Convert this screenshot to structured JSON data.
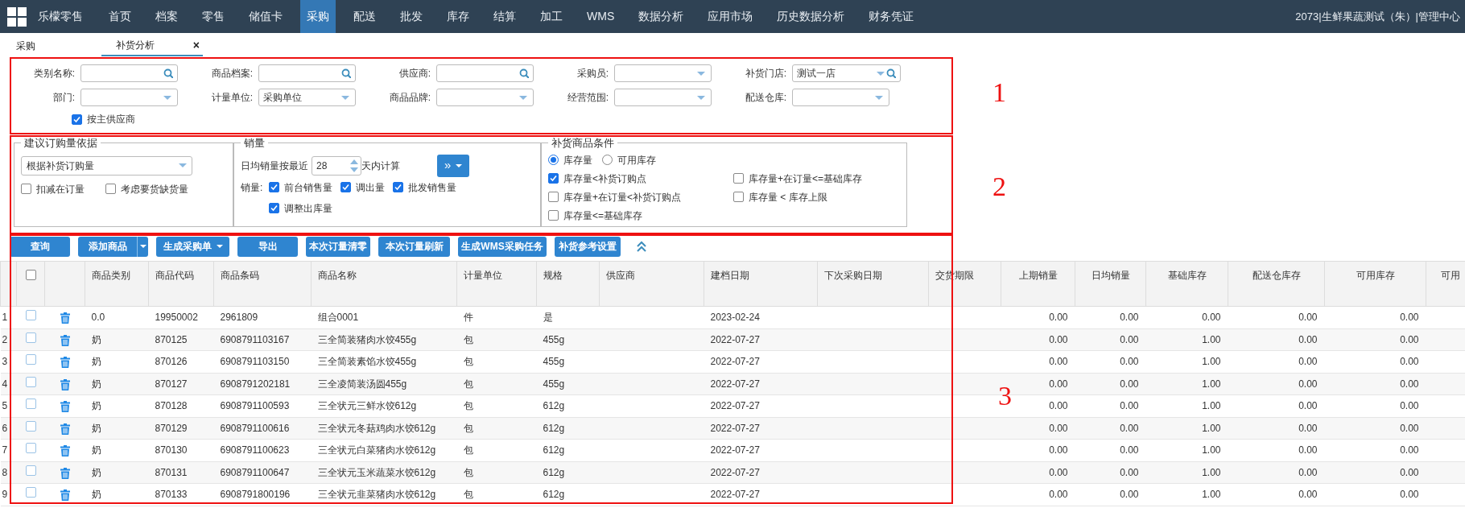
{
  "nav": {
    "brand": "乐檬零售",
    "items": [
      {
        "label": "首页",
        "selected": false
      },
      {
        "label": "档案",
        "selected": false
      },
      {
        "label": "零售",
        "selected": false
      },
      {
        "label": "储值卡",
        "selected": false
      },
      {
        "label": "采购",
        "selected": true
      },
      {
        "label": "配送",
        "selected": false
      },
      {
        "label": "批发",
        "selected": false
      },
      {
        "label": "库存",
        "selected": false
      },
      {
        "label": "结算",
        "selected": false
      },
      {
        "label": "加工",
        "selected": false
      },
      {
        "label": "WMS",
        "selected": false
      },
      {
        "label": "数据分析",
        "selected": false
      },
      {
        "label": "应用市场",
        "selected": false
      },
      {
        "label": "历史数据分析",
        "selected": false
      },
      {
        "label": "财务凭证",
        "selected": false
      }
    ],
    "user": "2073|生鲜果蔬测试（朱）|管理中心"
  },
  "tabs": [
    {
      "label": "采购",
      "selected": false
    },
    {
      "label": "补货分析",
      "selected": true,
      "close": "×"
    }
  ],
  "filters": [
    {
      "label": "类别名称:",
      "kind": "search"
    },
    {
      "label": "商品档案:",
      "kind": "search"
    },
    {
      "label": "供应商:",
      "kind": "search"
    },
    {
      "label": "采购员:",
      "kind": "select"
    },
    {
      "label": "补货门店:",
      "kind": "select_search",
      "value": "测试一店"
    },
    {
      "label": "部门:",
      "kind": "select"
    },
    {
      "label": "计量单位:",
      "kind": "select",
      "value": "采购单位"
    },
    {
      "label": "商品品牌:",
      "kind": "select"
    },
    {
      "label": "经营范围:",
      "kind": "select"
    },
    {
      "label": "配送仓库:",
      "kind": "select"
    }
  ],
  "main_supplier": {
    "label": "按主供应商",
    "checked": true
  },
  "basis": {
    "title": "建议订购量依据",
    "select": "根据补货订购量",
    "options": [
      {
        "label": "扣减在订量",
        "checked": false
      },
      {
        "label": "考虑要货缺货量",
        "checked": false
      }
    ]
  },
  "sales": {
    "title": "销量",
    "prefix": "日均销量按最近",
    "days": "28",
    "suffix": "天内计算",
    "more_button": "»",
    "sales_label": "销量:",
    "options": [
      {
        "label": "前台销售量",
        "checked": true
      },
      {
        "label": "调出量",
        "checked": true
      },
      {
        "label": "批发销售量",
        "checked": true
      },
      {
        "label": "调整出库量",
        "checked": true
      }
    ]
  },
  "conditions": {
    "title": "补货商品条件",
    "radios": [
      {
        "label": "库存量",
        "selected": true
      },
      {
        "label": "可用库存",
        "selected": false
      }
    ],
    "options": [
      {
        "label": "库存量<补货订购点",
        "checked": true
      },
      {
        "label": "库存量+在订量<=基础库存",
        "checked": false
      },
      {
        "label": "库存量+在订量<补货订购点",
        "checked": false
      },
      {
        "label": "库存量 < 库存上限",
        "checked": false
      },
      {
        "label": "库存量<=基础库存",
        "checked": false
      }
    ]
  },
  "toolbar": [
    {
      "label": "查询",
      "kind": "plain"
    },
    {
      "label": "添加商品",
      "kind": "split"
    },
    {
      "label": "生成采购单",
      "kind": "dropdown"
    },
    {
      "label": "导出",
      "kind": "plain"
    },
    {
      "label": "本次订量清零",
      "kind": "plain"
    },
    {
      "label": "本次订量刷新",
      "kind": "plain"
    },
    {
      "label": "生成WMS采购任务",
      "kind": "plain"
    },
    {
      "label": "补货参考设置",
      "kind": "plain"
    }
  ],
  "table": {
    "select_all": {
      "checked": false
    },
    "columns": [
      "商品类别",
      "商品代码",
      "商品条码",
      "商品名称",
      "计量单位",
      "规格",
      "供应商",
      "建档日期",
      "下次采购日期",
      "交货期限",
      "上期销量",
      "日均销量",
      "基础库存",
      "配送仓库存",
      "可用库存",
      "可用"
    ],
    "rows": [
      {
        "index": "1",
        "checked": false,
        "cells": [
          "0.0",
          "19950002",
          "2961809",
          "组合0001",
          "件",
          "是",
          null,
          "2023-02-24",
          null,
          null,
          "0.00",
          "0.00",
          "0.00",
          "0.00",
          "0.00"
        ]
      },
      {
        "index": "2",
        "checked": false,
        "cells": [
          "奶",
          "870125",
          "6908791103167",
          "三全简装猪肉水饺455g",
          "包",
          "455g",
          null,
          "2022-07-27",
          null,
          null,
          "0.00",
          "0.00",
          "1.00",
          "0.00",
          "0.00"
        ]
      },
      {
        "index": "3",
        "checked": false,
        "cells": [
          "奶",
          "870126",
          "6908791103150",
          "三全简装素馅水饺455g",
          "包",
          "455g",
          null,
          "2022-07-27",
          null,
          null,
          "0.00",
          "0.00",
          "1.00",
          "0.00",
          "0.00"
        ]
      },
      {
        "index": "4",
        "checked": false,
        "cells": [
          "奶",
          "870127",
          "6908791202181",
          "三全凌简装汤圆455g",
          "包",
          "455g",
          null,
          "2022-07-27",
          null,
          null,
          "0.00",
          "0.00",
          "1.00",
          "0.00",
          "0.00"
        ]
      },
      {
        "index": "5",
        "checked": false,
        "cells": [
          "奶",
          "870128",
          "6908791100593",
          "三全状元三鲜水饺612g",
          "包",
          "612g",
          null,
          "2022-07-27",
          null,
          null,
          "0.00",
          "0.00",
          "1.00",
          "0.00",
          "0.00"
        ]
      },
      {
        "index": "6",
        "checked": false,
        "cells": [
          "奶",
          "870129",
          "6908791100616",
          "三全状元冬菇鸡肉水饺612g",
          "包",
          "612g",
          null,
          "2022-07-27",
          null,
          null,
          "0.00",
          "0.00",
          "1.00",
          "0.00",
          "0.00"
        ]
      },
      {
        "index": "7",
        "checked": false,
        "cells": [
          "奶",
          "870130",
          "6908791100623",
          "三全状元白菜猪肉水饺612g",
          "包",
          "612g",
          null,
          "2022-07-27",
          null,
          null,
          "0.00",
          "0.00",
          "1.00",
          "0.00",
          "0.00"
        ]
      },
      {
        "index": "8",
        "checked": false,
        "cells": [
          "奶",
          "870131",
          "6908791100647",
          "三全状元玉米蔬菜水饺612g",
          "包",
          "612g",
          null,
          "2022-07-27",
          null,
          null,
          "0.00",
          "0.00",
          "1.00",
          "0.00",
          "0.00"
        ]
      },
      {
        "index": "9",
        "checked": false,
        "cells": [
          "奶",
          "870133",
          "6908791800196",
          "三全状元韭菜猪肉水饺612g",
          "包",
          "612g",
          null,
          "2022-07-27",
          null,
          null,
          "0.00",
          "0.00",
          "1.00",
          "0.00",
          "0.00"
        ]
      }
    ]
  },
  "annotations": [
    {
      "label": "1"
    },
    {
      "label": "2"
    },
    {
      "label": "3"
    }
  ]
}
